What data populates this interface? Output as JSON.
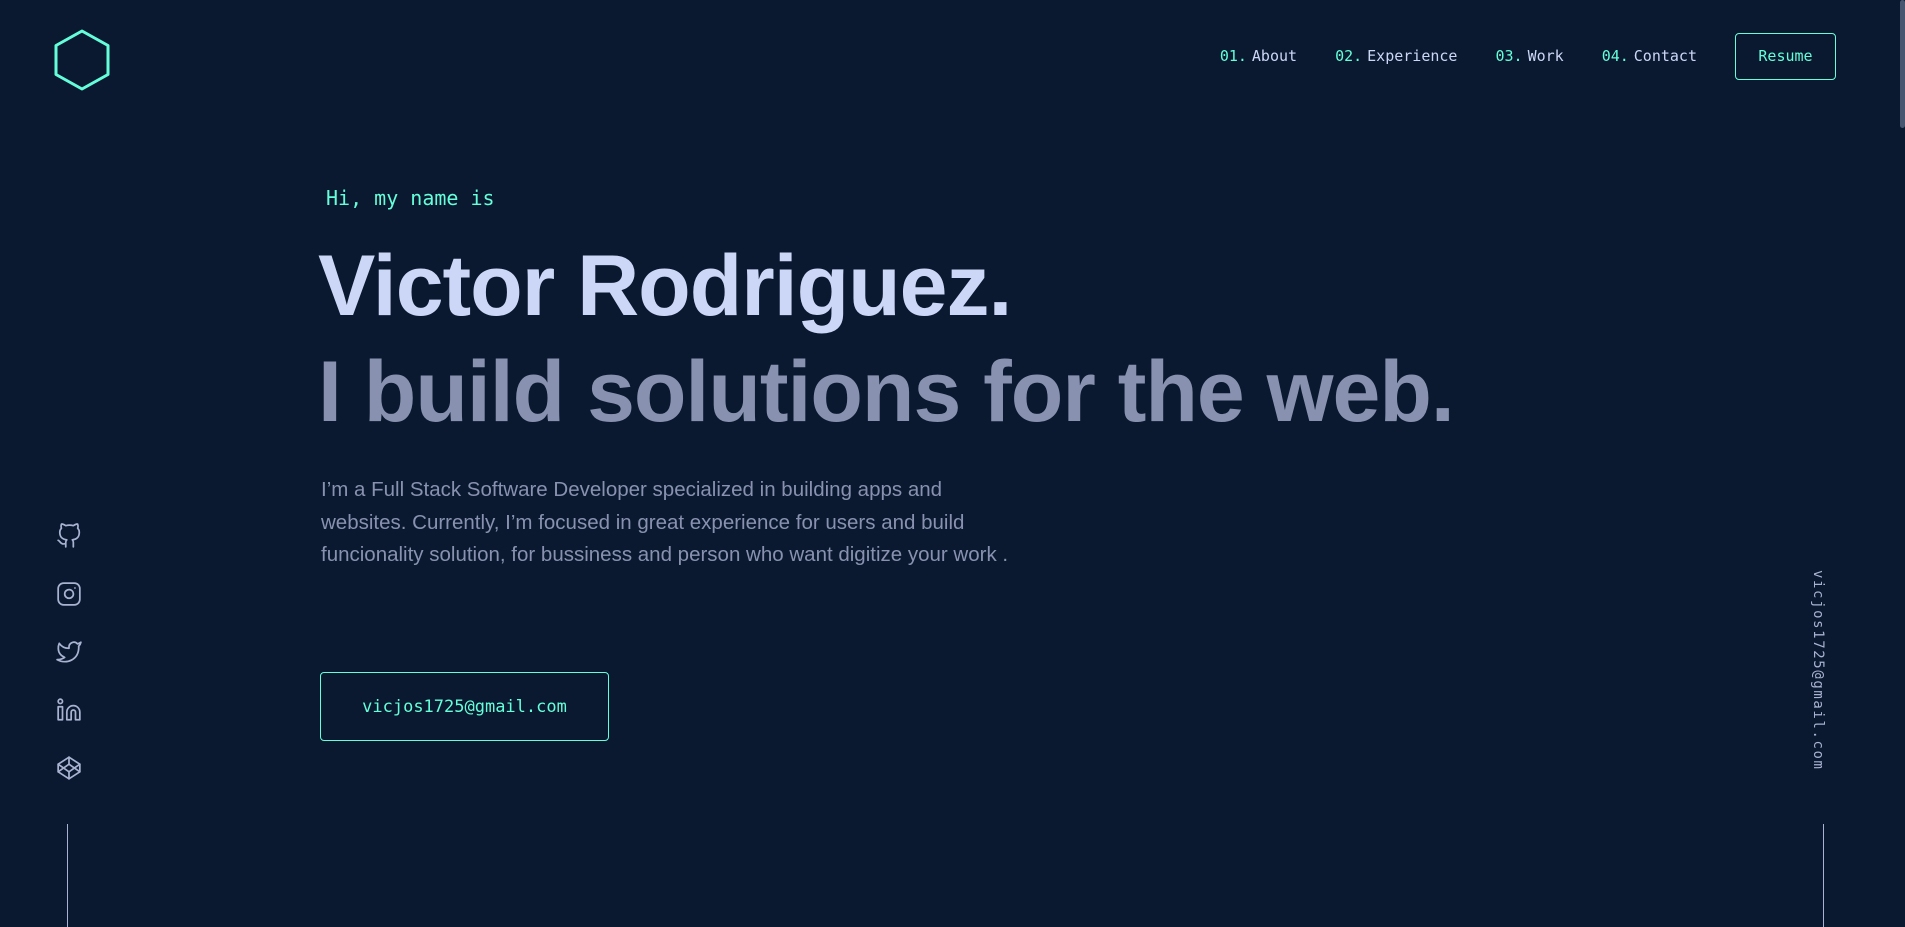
{
  "colors": {
    "background": "#0a192f",
    "accent": "#64ffda",
    "heading": "#ccd6f6",
    "text": "#8892b0"
  },
  "logo": {
    "icon": "hexagon-logo-icon"
  },
  "nav": {
    "items": [
      {
        "num": "01.",
        "label": "About"
      },
      {
        "num": "02.",
        "label": "Experience"
      },
      {
        "num": "03.",
        "label": "Work"
      },
      {
        "num": "04.",
        "label": "Contact"
      }
    ],
    "resume_label": "Resume"
  },
  "hero": {
    "intro": "Hi, my name is",
    "name": "Victor Rodriguez.",
    "tagline": "I build solutions for the web.",
    "bio": "I’m a Full Stack Software Developer specialized in building apps and websites. Currently, I’m focused in great experience for users and build funcionality solution, for bussiness and person who want digitize your work .",
    "cta_email": "vicjos1725@gmail.com"
  },
  "social": {
    "icons": [
      "github-icon",
      "instagram-icon",
      "twitter-icon",
      "linkedin-icon",
      "codepen-icon"
    ]
  },
  "side_email": "vicjos1725@gmail.com"
}
